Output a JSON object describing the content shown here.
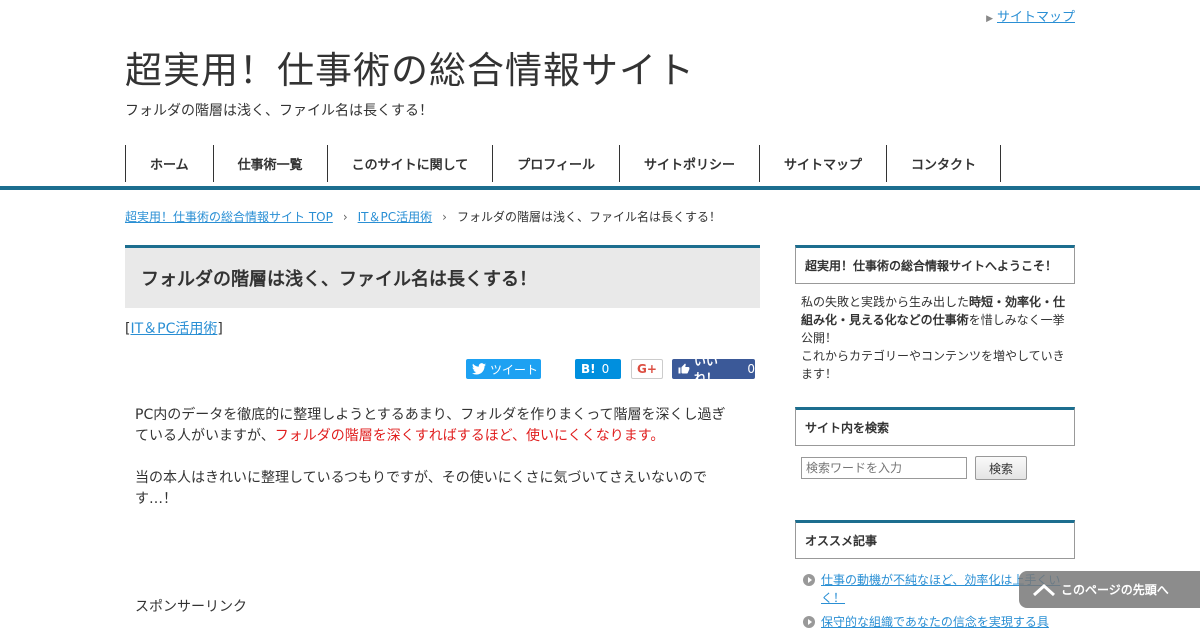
{
  "header": {
    "sitemap_link": "サイトマップ",
    "site_title": "超実用！仕事術の総合情報サイト",
    "site_description": "フォルダの階層は浅く、ファイル名は長くする！"
  },
  "global_nav": [
    "ホーム",
    "仕事術一覧",
    "このサイトに関して",
    "プロフィール",
    "サイトポリシー",
    "サイトマップ",
    "コンタクト"
  ],
  "breadcrumb": {
    "home": "超実用！仕事術の総合情報サイト TOP",
    "category": "IT＆PC活用術",
    "current": "フォルダの階層は浅く、ファイル名は長くする！"
  },
  "article": {
    "title": "フォルダの階層は浅く、ファイル名は長くする！",
    "category_open": "[",
    "category_link": "IT＆PC活用術",
    "category_close": "]",
    "share": {
      "tweet": "ツイート",
      "hatena_label": "B!",
      "hatena_count": "0",
      "gplus": "G+",
      "like_label": "いいね！",
      "like_count": "0"
    },
    "para1_a": "PC内のデータを徹底的に整理しようとするあまり、フォルダを作りまくって階層を深くし過ぎている人がいますが、",
    "para1_red": "フォルダの階層を深くすればするほど、使いにくくなります。",
    "para2": "当の本人はきれいに整理しているつもりですが、その使いにくさに気づいてさえいないのです…！",
    "sponsor": "スポンサーリンク"
  },
  "sidebar": {
    "welcome_title": "超実用！仕事術の総合情報サイトへようこそ！",
    "welcome_a": "私の失敗と実践から生み出した",
    "welcome_bold": "時短・効率化・仕組み化・見える化などの仕事術",
    "welcome_b": "を惜しみなく一挙公開！",
    "welcome_c": "これからカテゴリーやコンテンツを増やしていきます！",
    "search_title": "サイト内を検索",
    "search_placeholder": "検索ワードを入力",
    "search_button": "検索",
    "recommend_title": "オススメ記事",
    "recommend_items": [
      "仕事の動機が不純なほど、効率化は上手くいく！",
      "保守的な組織であなたの信念を実現する具"
    ]
  },
  "to_top": "このページの先頭へ",
  "colors": {
    "accent": "#1c6e8f",
    "link": "#2a8fd4",
    "highlight": "#e01e1e"
  }
}
